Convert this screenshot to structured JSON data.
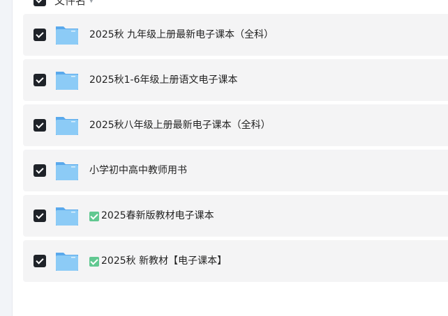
{
  "header": {
    "column_label": "文件名",
    "sort_icon": "caret-down-icon"
  },
  "files": [
    {
      "name": "2025秋 九年级上册最新电子课本（全科）",
      "checked": true,
      "badge": false,
      "icon": "folder-icon"
    },
    {
      "name": "2025秋1-6年级上册语文电子课本",
      "checked": true,
      "badge": false,
      "icon": "folder-icon"
    },
    {
      "name": "2025秋八年级上册最新电子课本（全科）",
      "checked": true,
      "badge": false,
      "icon": "folder-icon"
    },
    {
      "name": "小学初中高中教师用书",
      "checked": true,
      "badge": false,
      "icon": "folder-icon"
    },
    {
      "name": "2025春新版教材电子课本",
      "checked": true,
      "badge": true,
      "icon": "folder-icon"
    },
    {
      "name": "2025秋 新教材【电子课本】",
      "checked": true,
      "badge": true,
      "icon": "folder-icon"
    }
  ],
  "colors": {
    "checkbox": "#1f2329",
    "row_bg": "#f4f4f5",
    "folder": "#6cb6f2",
    "badge": "#61c891"
  }
}
